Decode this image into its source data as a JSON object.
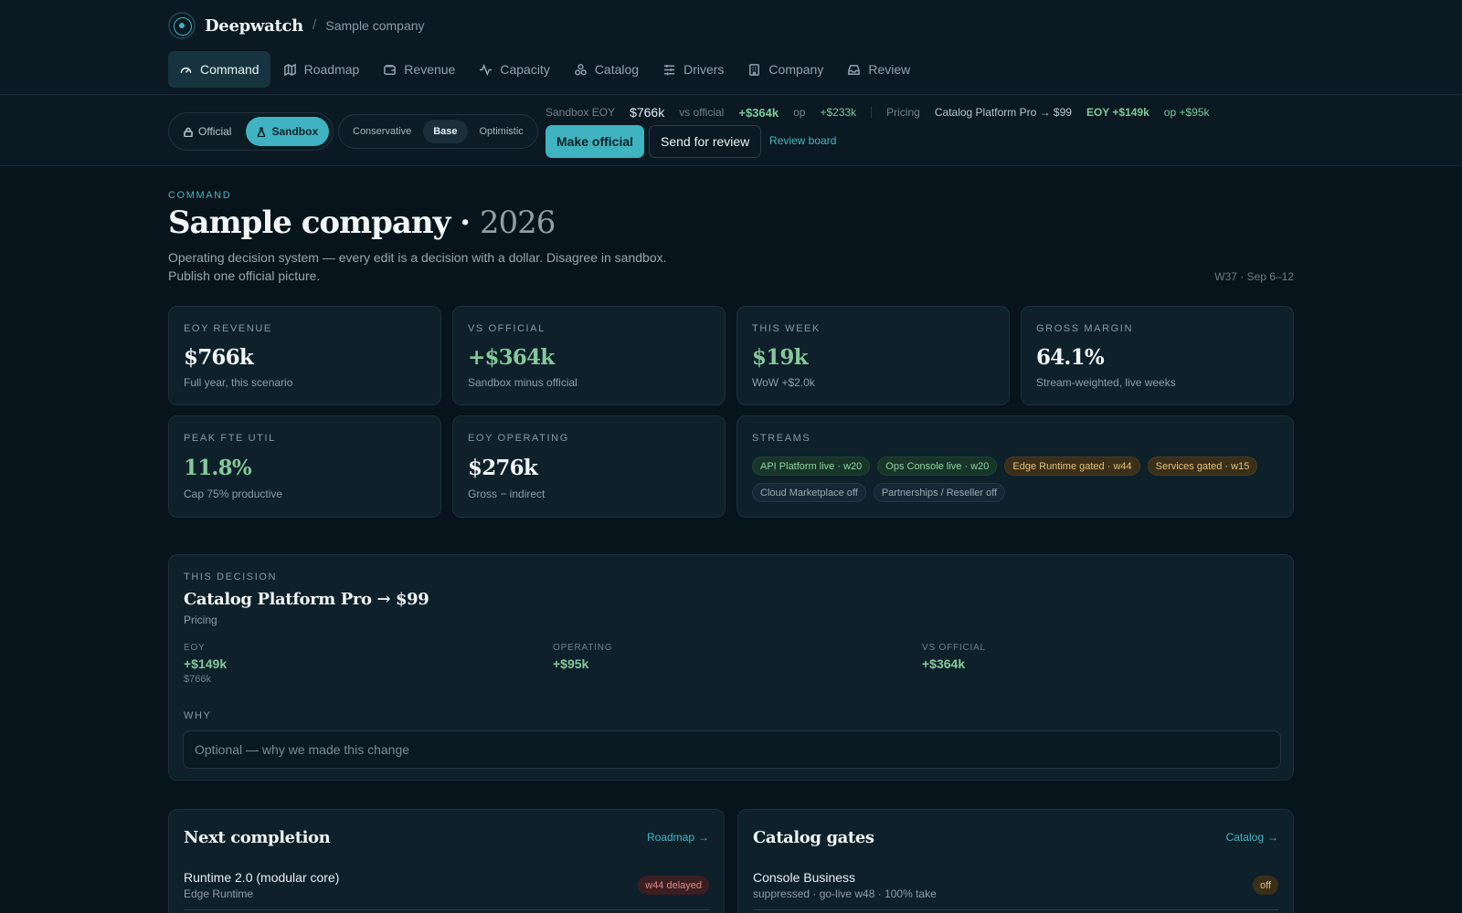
{
  "app": {
    "name": "Deepwatch",
    "company": "Sample company",
    "separator": "/"
  },
  "nav": [
    {
      "label": "Command",
      "icon": "gauge-icon",
      "active": true
    },
    {
      "label": "Roadmap",
      "icon": "map-icon",
      "active": false
    },
    {
      "label": "Revenue",
      "icon": "wallet-icon",
      "active": false
    },
    {
      "label": "Capacity",
      "icon": "activity-icon",
      "active": false
    },
    {
      "label": "Catalog",
      "icon": "boxes-icon",
      "active": false
    },
    {
      "label": "Drivers",
      "icon": "sliders-icon",
      "active": false
    },
    {
      "label": "Company",
      "icon": "building-icon",
      "active": false
    },
    {
      "label": "Review",
      "icon": "inbox-icon",
      "active": false
    }
  ],
  "scenario": {
    "modes": [
      {
        "label": "Official",
        "icon": "lock-icon",
        "active": false
      },
      {
        "label": "Sandbox",
        "icon": "flask-icon",
        "active": true
      }
    ],
    "cases": [
      {
        "label": "Conservative",
        "active": false
      },
      {
        "label": "Base",
        "active": true
      },
      {
        "label": "Optimistic",
        "active": false
      }
    ],
    "summary": {
      "sandbox_eoy_label": "Sandbox EOY",
      "sandbox_eoy_value": "$766k",
      "vs_official_label": "vs official",
      "vs_official_value": "+$364k",
      "op_label": "op",
      "op_value": "+$233k",
      "pricing_label": "Pricing",
      "pricing_change": "Catalog Platform Pro → $99",
      "eoy_delta": "EOY +$149k",
      "op_delta": "op +$95k"
    },
    "make_official": "Make official",
    "send_review": "Send for review",
    "review_board": "Review board"
  },
  "page": {
    "eyebrow": "COMMAND",
    "title": "Sample company ·",
    "year": "2026",
    "subtitle": "Operating decision system — every edit is a decision with a dollar. Disagree in sandbox. Publish one official picture.",
    "week": "W37 · Sep 6–12"
  },
  "kpis": [
    {
      "label": "EOY REVENUE",
      "value": "$766k",
      "sub": "Full year, this scenario",
      "tone": "neutral"
    },
    {
      "label": "VS OFFICIAL",
      "value": "+$364k",
      "sub": "Sandbox minus official",
      "tone": "good"
    },
    {
      "label": "THIS WEEK",
      "value": "$19k",
      "sub": "WoW +$2.0k",
      "tone": "good"
    },
    {
      "label": "GROSS MARGIN",
      "value": "64.1%",
      "sub": "Stream-weighted, live weeks",
      "tone": "neutral"
    },
    {
      "label": "PEAK FTE UTIL",
      "value": "11.8%",
      "sub": "Cap 75% productive",
      "tone": "good"
    },
    {
      "label": "EOY OPERATING",
      "value": "$276k",
      "sub": "Gross − indirect",
      "tone": "neutral"
    }
  ],
  "streams": {
    "label": "STREAMS",
    "items": [
      {
        "text": "API Platform live · w20",
        "status": "live"
      },
      {
        "text": "Ops Console live · w20",
        "status": "live"
      },
      {
        "text": "Edge Runtime gated · w44",
        "status": "gated"
      },
      {
        "text": "Services gated · w15",
        "status": "gated"
      },
      {
        "text": "Cloud Marketplace off",
        "status": "off"
      },
      {
        "text": "Partnerships / Reseller off",
        "status": "off"
      }
    ]
  },
  "decision": {
    "eyebrow": "THIS DECISION",
    "title": "Catalog Platform Pro → $99",
    "category": "Pricing",
    "metrics": [
      {
        "label": "EOY",
        "value": "+$149k",
        "sub": "$766k"
      },
      {
        "label": "OPERATING",
        "value": "+$95k",
        "sub": ""
      },
      {
        "label": "VS OFFICIAL",
        "value": "+$364k",
        "sub": ""
      }
    ],
    "why_label": "WHY",
    "why_placeholder": "Optional — why we made this change",
    "why_value": ""
  },
  "next_completion": {
    "title": "Next completion",
    "link": "Roadmap",
    "rows": [
      {
        "title": "Runtime 2.0 (modular core)",
        "sub": "Edge Runtime",
        "badge": "w44 delayed",
        "badge_tone": "red"
      }
    ]
  },
  "catalog_gates": {
    "title": "Catalog gates",
    "link": "Catalog",
    "rows": [
      {
        "title": "Console Business",
        "sub": "suppressed · go-live w48 · 100% take",
        "badge": "off",
        "badge_tone": "amber"
      }
    ]
  }
}
